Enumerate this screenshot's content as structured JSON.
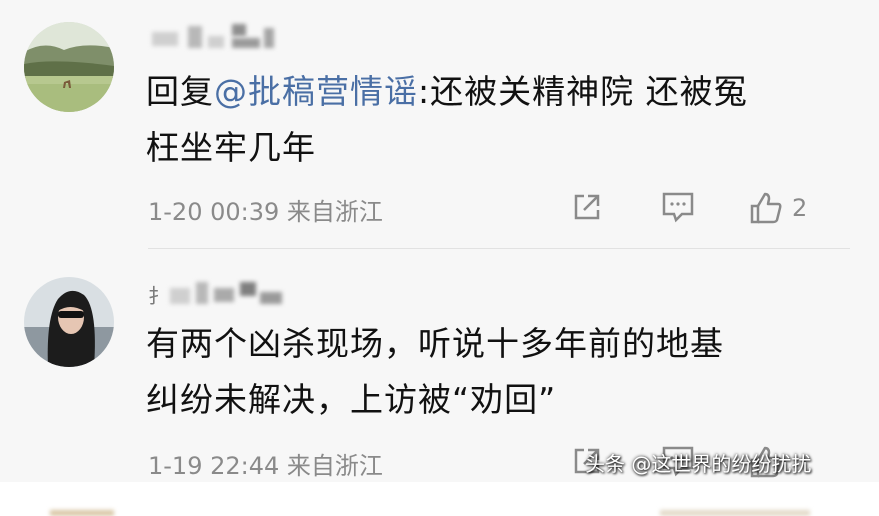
{
  "comments": [
    {
      "username": "",
      "text_prefix": "回复",
      "mention": "@批稿营情谣",
      "text_line1_rest": ":还被关精神院 还被冤",
      "text_line2": "枉坐牢几年",
      "time": "1-20 00:39",
      "source": "来自浙江",
      "likes": "2"
    },
    {
      "username": "扌",
      "text_line1": "有两个凶杀现场，听说十多年前的地基",
      "text_line2": "纠纷未解决，上访被“劝回”",
      "time": "1-19 22:44",
      "source": "来自浙江",
      "likes": ""
    }
  ],
  "watermark": "头条 @这世界的纷纷扰扰",
  "icons": {
    "share": "share-icon",
    "comment": "comment-icon",
    "like": "thumbs-up-icon"
  },
  "colors": {
    "background": "#f7f7f7",
    "mention": "#4a6fa5",
    "meta": "#8a8a8a",
    "text": "#111111"
  }
}
